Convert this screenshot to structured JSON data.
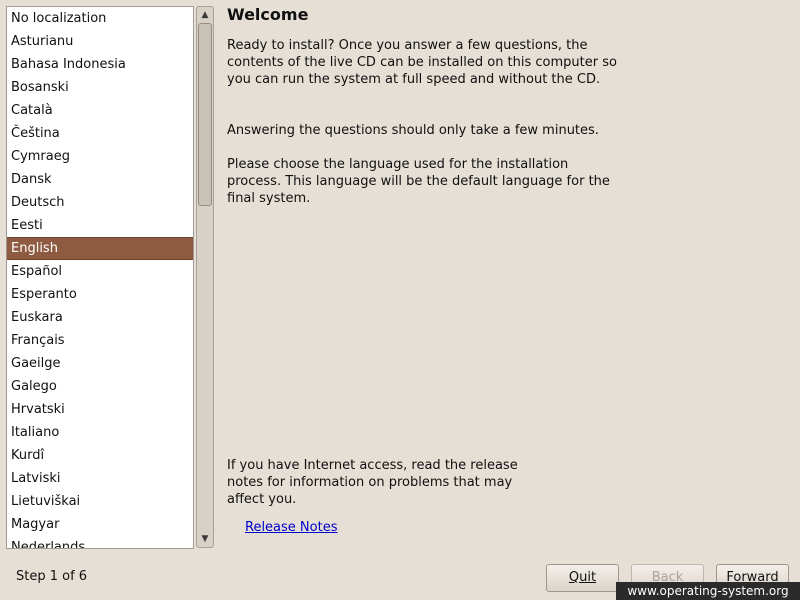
{
  "languages": [
    "No localization",
    "Asturianu",
    "Bahasa Indonesia",
    "Bosanski",
    "Català",
    "Čeština",
    "Cymraeg",
    "Dansk",
    "Deutsch",
    "Eesti",
    "English",
    "Español",
    "Esperanto",
    "Euskara",
    "Français",
    "Gaeilge",
    "Galego",
    "Hrvatski",
    "Italiano",
    "Kurdî",
    "Latviski",
    "Lietuviškai",
    "Magyar",
    "Nederlands"
  ],
  "selected_language": "English",
  "heading": "Welcome",
  "paragraphs": {
    "intro": "Ready to install? Once you answer a few questions, the contents of the live CD can be installed on this computer so you can run the system at full speed and without the CD.",
    "minutes": "Answering the questions should only take a few minutes.",
    "choose": "Please choose the language used for the installation process. This language will be the default language for the final system.",
    "internet": "If you have Internet access, read the release notes for information on problems that may affect you."
  },
  "release_notes_link": "Release Notes",
  "step": "Step 1 of 6",
  "buttons": {
    "quit": "Quit",
    "back": "Back",
    "forward": "Forward"
  },
  "watermark": "www.operating-system.org",
  "scrollbar": {
    "up_icon": "triangle-up",
    "down_icon": "triangle-down"
  },
  "colors": {
    "selection": "#8f5b40",
    "background": "#e6dfd6",
    "link": "#0000cc"
  }
}
